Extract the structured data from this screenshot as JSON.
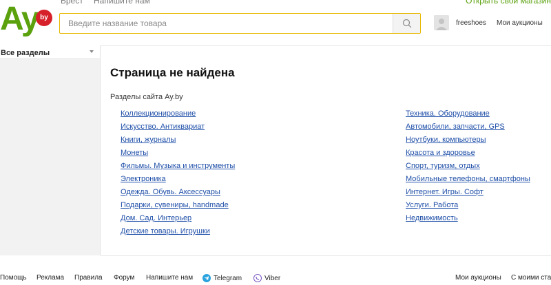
{
  "top_bar": {
    "city": "Брест",
    "write_us": "Напишите нам",
    "open_shop": "Открыть свой магазин"
  },
  "logo": {
    "text": "Ay",
    "badge": "by"
  },
  "search": {
    "placeholder": "Введите название товара",
    "button_icon": "search-icon"
  },
  "user": {
    "avatar_icon": "user-avatar-icon",
    "name": "freeshoes",
    "my_auctions": "Мои аукционы"
  },
  "sidebar": {
    "all_sections": "Все разделы",
    "dropdown_icon": "chevron-down-icon"
  },
  "main": {
    "title": "Страница не найдена",
    "sections_label": "Разделы сайта Ay.by",
    "left_links": [
      "Коллекционирование",
      "Искусство. Антиквариат",
      "Книги, журналы",
      "Монеты",
      "Фильмы. Музыка и инструменты",
      "Электроника",
      "Одежда. Обувь. Аксессуары",
      "Подарки, сувениры, handmade",
      "Дом. Сад. Интерьер",
      "Детские товары. Игрушки"
    ],
    "right_links": [
      "Техника. Оборудование",
      "Автомобили, запчасти, GPS",
      "Ноутбуки, компьютеры",
      "Красота и здоровье",
      "Спорт, туризм, отдых",
      "Мобильные телефоны, смартфоны",
      "Интернет. Игры. Софт",
      "Услуги. Работа",
      "Недвижимость"
    ]
  },
  "footer": {
    "help": "Помощь",
    "ads": "Реклама",
    "rules": "Правила",
    "forum": "Форум",
    "write_us": "Напишите нам",
    "telegram": "Telegram",
    "viber": "Viber",
    "my_auctions": "Мои аукционы",
    "my_bets": "С моими ставками"
  },
  "colors": {
    "brand_green": "#5aa10d",
    "badge_red": "#d6212b",
    "link_blue": "#1f4fa8",
    "search_border": "#e6b800",
    "telegram_blue": "#2aa3de",
    "viber_purple": "#7b5ac6"
  }
}
